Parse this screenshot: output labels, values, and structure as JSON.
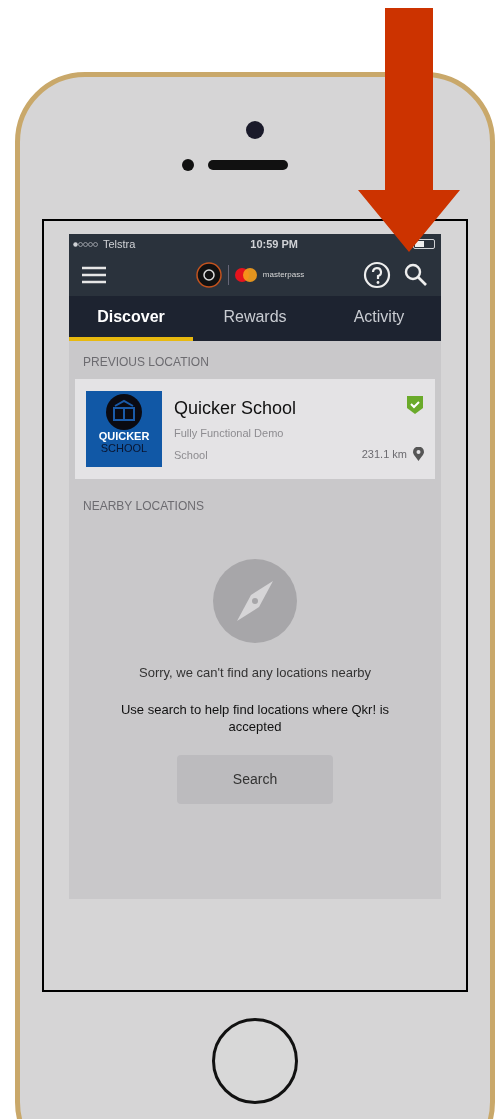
{
  "status_bar": {
    "carrier": "Telstra",
    "time": "10:59 PM"
  },
  "header": {
    "brand": "masterpass"
  },
  "tabs": [
    {
      "label": "Discover",
      "selected": true
    },
    {
      "label": "Rewards",
      "selected": false
    },
    {
      "label": "Activity",
      "selected": false
    }
  ],
  "previous_location": {
    "heading": "PREVIOUS LOCATION",
    "name": "Quicker School",
    "description": "Fully Functional Demo School",
    "distance": "231.1 km",
    "verified": true,
    "logo_lines": [
      "QUICKER",
      "SCHOOL"
    ]
  },
  "nearby": {
    "heading": "NEARBY LOCATIONS",
    "message": "Sorry, we can't find any locations nearby",
    "hint": "Use search to help find locations where Qkr! is accepted",
    "button": "Search"
  }
}
